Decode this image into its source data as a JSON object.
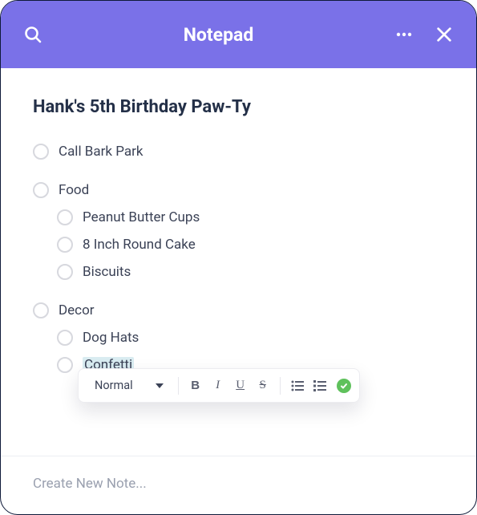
{
  "header": {
    "title": "Notepad"
  },
  "note": {
    "title": "Hank's 5th Birthday Paw-Ty",
    "items": [
      {
        "label": "Call Bark Park"
      },
      {
        "label": "Food",
        "children": [
          {
            "label": "Peanut Butter Cups"
          },
          {
            "label": "8 Inch Round Cake"
          },
          {
            "label": "Biscuits"
          }
        ]
      },
      {
        "label": "Decor",
        "children": [
          {
            "label": "Dog Hats"
          },
          {
            "label": "Confetti",
            "selected": true
          }
        ]
      }
    ]
  },
  "toolbar": {
    "style": "Normal",
    "bold": "B",
    "italic": "I",
    "underline": "U",
    "strike": "S"
  },
  "footer": {
    "placeholder": "Create New Note..."
  }
}
